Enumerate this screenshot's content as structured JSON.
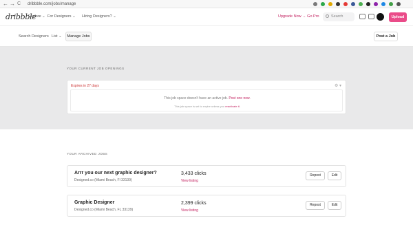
{
  "browser": {
    "back": "←",
    "forward": "→",
    "reload": "C",
    "url": "dribbble.com/jobs/manage",
    "extension_colors": [
      "#7a7a7a",
      "#2ba84a",
      "#e0a800",
      "#333333",
      "#e53935",
      "#3b5998",
      "#4caf50",
      "#222222",
      "#8e24aa",
      "#1e88e5",
      "#43a047",
      "#555555"
    ]
  },
  "header": {
    "logo": "dribbble",
    "nav": [
      {
        "label": "Explore ⌄"
      },
      {
        "label": "For Designers ⌄"
      },
      {
        "label": "Hiring Designers? ⌄"
      }
    ],
    "upgrade": "Upgrade Now → Go Pro",
    "search_placeholder": "Search",
    "upload": "Upload",
    "accent": "#ea4c89"
  },
  "subnav": {
    "search_designers": "Search Designers",
    "list": "List ⌄",
    "manage_jobs": "Manage Jobs",
    "post_job": "Post a Job"
  },
  "current": {
    "title": "YOUR CURRENT JOB OPENINGS",
    "expires": "Expires in 27 days",
    "gear": "⚙ ▾",
    "message_prefix": "This job space doesn't have an active job.",
    "message_link": "Post one now.",
    "expire_prefix": "This job space is set to expire unless you",
    "expire_link": "reactivate it."
  },
  "archived": {
    "title": "YOUR ARCHIVED JOBS",
    "jobs": [
      {
        "title": "Arrr you our next graphic designer?",
        "company": "Designed.co (Miami Beach, Fl 33139)",
        "clicks": "3,433 clicks",
        "link": "View listing",
        "repost": "Repost",
        "edit": "Edit"
      },
      {
        "title": "Graphic Designer",
        "company": "Designed.co (Miami Beach, FL 33139)",
        "clicks": "2,399 clicks",
        "link": "View listing",
        "repost": "Repost",
        "edit": "Edit"
      }
    ]
  }
}
